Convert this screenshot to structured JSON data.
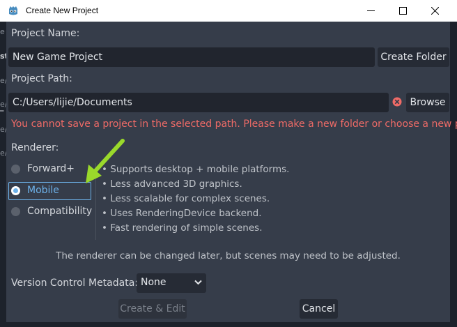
{
  "window": {
    "title": "Create New Project",
    "controls": {
      "minimize": "minimize-icon",
      "maximize": "maximize-icon",
      "close": "close-icon"
    }
  },
  "background": {
    "strip_letters": [
      "e",
      "st",
      "e/",
      "e/",
      "_",
      "e/",
      "e/"
    ]
  },
  "project_name": {
    "label": "Project Name:",
    "value": "New Game Project",
    "create_folder_label": "Create Folder"
  },
  "project_path": {
    "label": "Project Path:",
    "value": "C:/Users/lijie/Documents",
    "browse_label": "Browse",
    "error_icon": "error-x-circle-icon",
    "error_message": "You cannot save a project in the selected path. Please make a new folder or choose a new path."
  },
  "renderer": {
    "label": "Renderer:",
    "options": [
      {
        "label": "Forward+",
        "selected": false
      },
      {
        "label": "Mobile",
        "selected": true
      },
      {
        "label": "Compatibility",
        "selected": false
      }
    ],
    "features": [
      "Supports desktop + mobile platforms.",
      "Less advanced 3D graphics.",
      "Less scalable for complex scenes.",
      "Uses RenderingDevice backend.",
      "Fast rendering of simple scenes."
    ],
    "bullet_char": "•",
    "hint": "The renderer can be changed later, but scenes may need to be adjusted."
  },
  "version_control": {
    "label": "Version Control Metadata:",
    "selected": "None"
  },
  "footer": {
    "create_edit_label": "Create & Edit",
    "cancel_label": "Cancel"
  },
  "colors": {
    "accent": "#6db2ea",
    "error": "#ef6b67",
    "annotation_arrow": "#9ad92b"
  }
}
